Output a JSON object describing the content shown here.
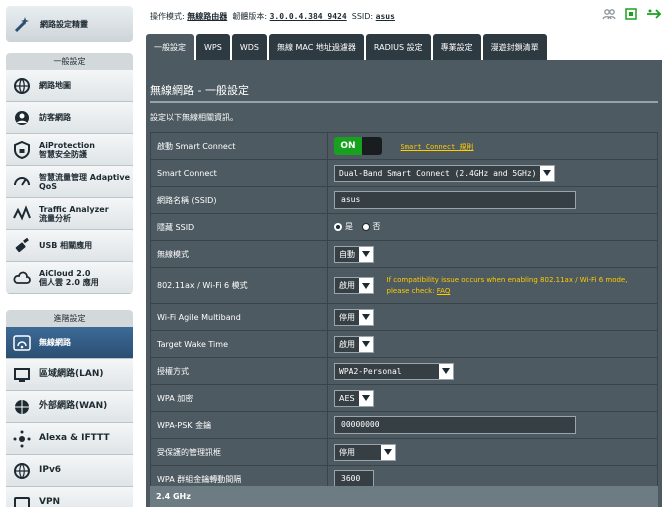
{
  "sidebar": {
    "brand_label": "網路設定精靈",
    "general_header": "一般設定",
    "general_items": [
      {
        "label": "網路地圖",
        "icon": "globe-icon"
      },
      {
        "label": "訪客網路",
        "icon": "guest-network-icon"
      },
      {
        "label": "AiProtection\n智慧安全防護",
        "icon": "shield-lock-icon"
      },
      {
        "label": "智慧流量管理 Adaptive\nQoS",
        "icon": "gauge-icon"
      },
      {
        "label": "Traffic Analyzer\n流量分析",
        "icon": "traffic-analyzer-icon"
      },
      {
        "label": "USB 相關應用",
        "icon": "usb-icon"
      },
      {
        "label": "AiCloud 2.0\n個人雲 2.0 應用",
        "icon": "cloud-icon"
      }
    ],
    "advanced_header": "進階設定",
    "advanced_items": [
      {
        "label": "無線網路",
        "icon": "wifi-icon",
        "active": true
      },
      {
        "label": "區域網路(LAN)",
        "icon": "lan-icon"
      },
      {
        "label": "外部網路(WAN)",
        "icon": "wan-globe-icon"
      },
      {
        "label": "Alexa & IFTTT",
        "icon": "alexa-ifttt-icon"
      },
      {
        "label": "IPv6",
        "icon": "ipv6-icon"
      },
      {
        "label": "VPN",
        "icon": "vpn-icon"
      }
    ]
  },
  "topbar": {
    "opmode_label": "操作模式:",
    "opmode_value": "無線路由器",
    "firmware_label": "韌體版本:",
    "firmware_value": "3.0.0.4.384_9424",
    "ssid_label": "SSID:",
    "ssid_value": "asus"
  },
  "tabs": [
    "一般設定",
    "WPS",
    "WDS",
    "無線 MAC 地址過濾器",
    "RADIUS 設定",
    "專業設定",
    "漫遊封鎖清單"
  ],
  "main": {
    "title": "無線網路 - 一般設定",
    "description": "設定以下無線相關資訊。",
    "rows": {
      "smart_connect_enable": {
        "label": "啟動 Smart Connect",
        "toggle": "ON",
        "link": "Smart Connect 規則"
      },
      "smart_connect": {
        "label": "Smart Connect",
        "value": "Dual-Band Smart Connect (2.4GHz and 5GHz)"
      },
      "ssid": {
        "label": "網路名稱 (SSID)",
        "value": "asus"
      },
      "hide_ssid": {
        "label": "隱藏 SSID",
        "yes": "是",
        "no": "否",
        "selected": "yes"
      },
      "wireless_mode": {
        "label": "無線模式",
        "value": "自動"
      },
      "ax_mode": {
        "label": "802.11ax / Wi-Fi 6 模式",
        "value": "啟用",
        "warning": "If compatibility issue occurs when enabling 802.11ax / Wi-Fi 6 mode,",
        "warning2": "please check:",
        "faq": "FAQ"
      },
      "agile": {
        "label": "Wi-Fi Agile Multiband",
        "value": "停用"
      },
      "twt": {
        "label": "Target Wake Time",
        "value": "啟用"
      },
      "auth": {
        "label": "授權方式",
        "value": "WPA2-Personal"
      },
      "wpa_enc": {
        "label": "WPA 加密",
        "value": "AES"
      },
      "psk": {
        "label": "WPA-PSK 金鑰",
        "value": "00000000"
      },
      "pmf": {
        "label": "受保護的管理訊框",
        "value": "停用"
      },
      "gtk": {
        "label": "WPA 群組金鑰轉動間隔",
        "value": "3600"
      }
    },
    "band_label": "2.4 GHz"
  }
}
